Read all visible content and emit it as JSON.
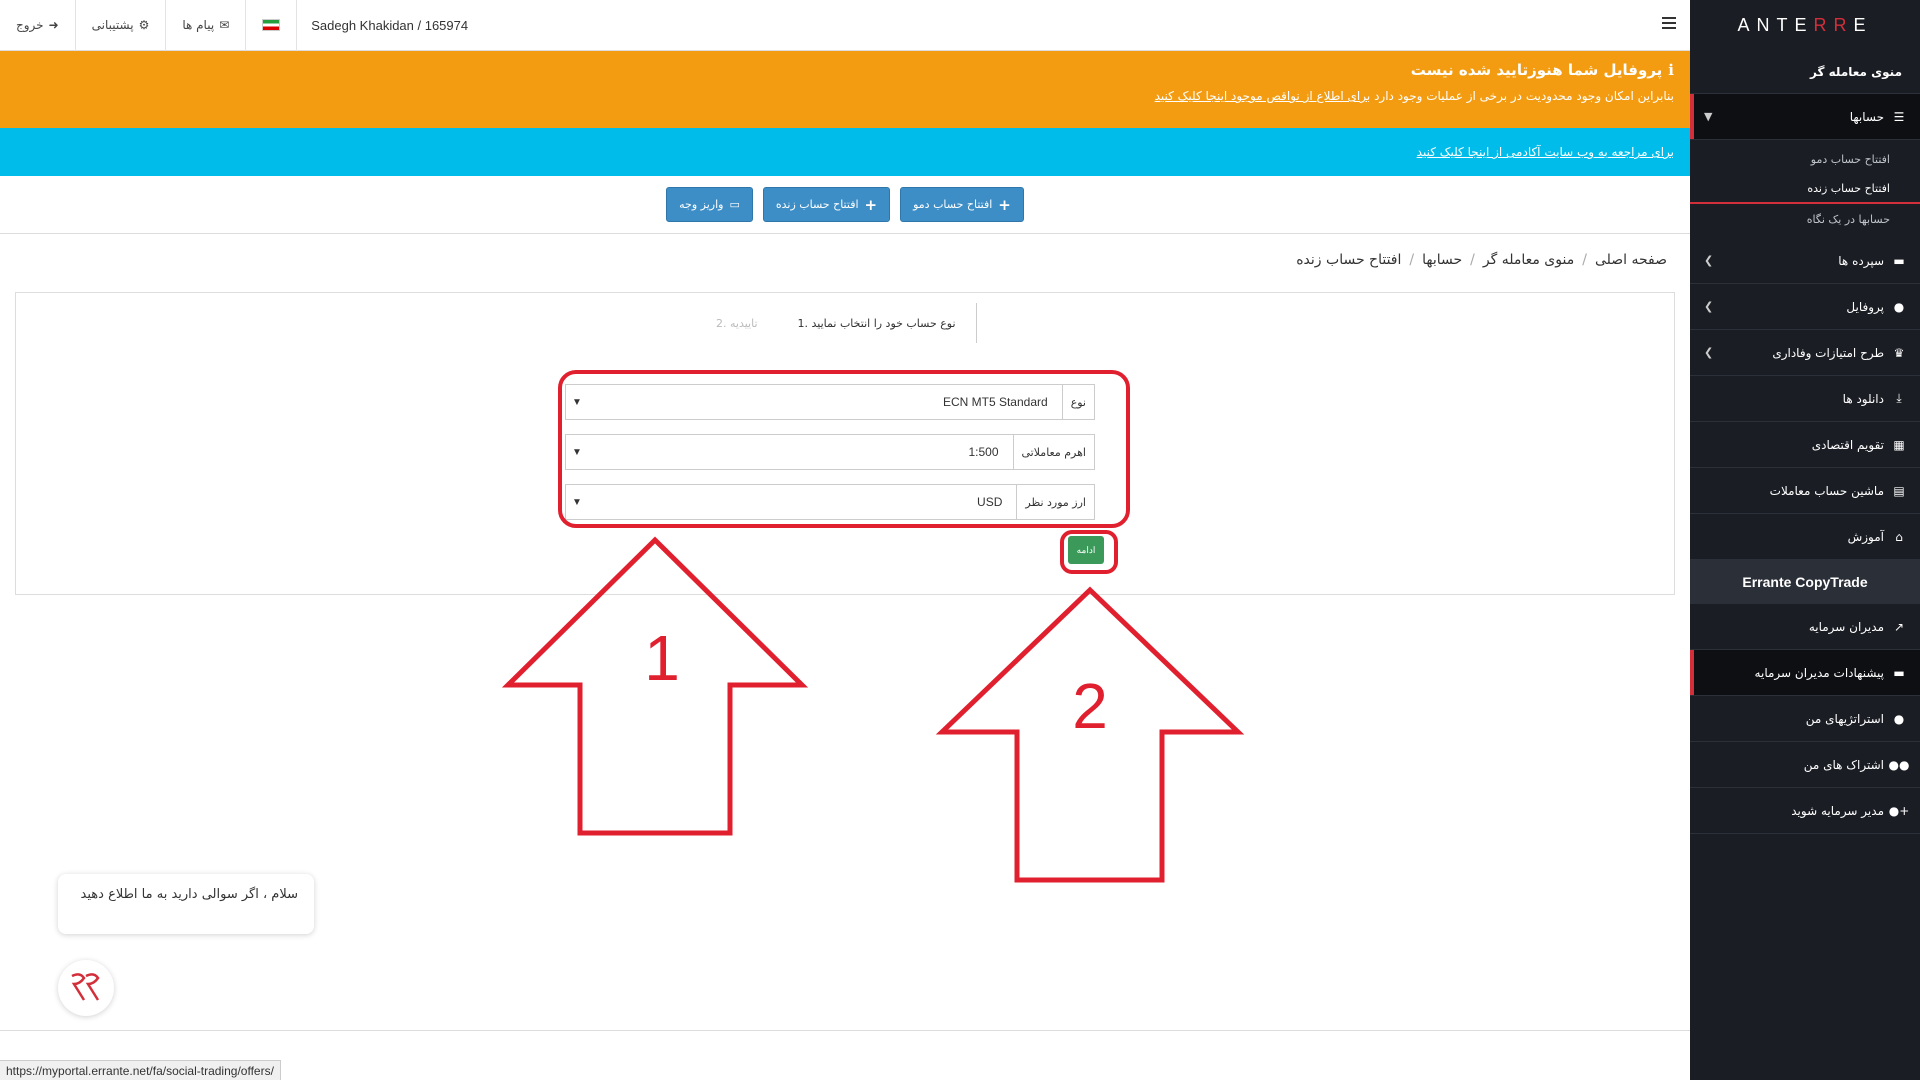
{
  "logo": {
    "pre": "E",
    "mid": "RR",
    "post": "ANTE"
  },
  "sidebar": {
    "title": "منوی معامله گر",
    "accounts": {
      "label": "حسابها",
      "sub": [
        "افتتاح حساب دمو",
        "افتتاح حساب زنده",
        "حسابها در یک نگاه"
      ]
    },
    "items": [
      {
        "label": "سپرده ها",
        "icon": "card-icon",
        "glyph": "▬",
        "chevron": true
      },
      {
        "label": "پروفایل",
        "icon": "user-icon",
        "glyph": "●",
        "chevron": true
      },
      {
        "label": "طرح امتیازات وفاداری",
        "icon": "trophy-icon",
        "glyph": "♛",
        "chevron": true
      },
      {
        "label": "دانلود ها",
        "icon": "download-icon",
        "glyph": "⤓",
        "chevron": false
      },
      {
        "label": "تقویم اقتصادی",
        "icon": "calendar-icon",
        "glyph": "▦",
        "chevron": false
      },
      {
        "label": "ماشین حساب معاملات",
        "icon": "calculator-icon",
        "glyph": "▤",
        "chevron": false
      },
      {
        "label": "آموزش",
        "icon": "institution-icon",
        "glyph": "⌂",
        "chevron": false
      }
    ],
    "copytrade_title": "Errante CopyTrade",
    "copytrade_items": [
      {
        "label": "مدیران سرمایه",
        "icon": "chart-icon",
        "glyph": "↗"
      },
      {
        "label": "پیشنهادات مدیران سرمایه",
        "icon": "card-icon",
        "glyph": "▬"
      },
      {
        "label": "استراتژیهای من",
        "icon": "user-tie-icon",
        "glyph": "●"
      },
      {
        "label": "اشتراک های من",
        "icon": "users-icon",
        "glyph": "●●"
      },
      {
        "label": "مدیر سرمایه شوید",
        "icon": "user-plus-icon",
        "glyph": "+●"
      }
    ]
  },
  "topbar": {
    "logout": "خروج",
    "support": "پشتیبانی",
    "messages": "پیام ها",
    "user": "Sadegh Khakidan / 165974"
  },
  "banner": {
    "title": "پروفایل شما هنوزتایید شده نیست",
    "text": "بنابراین امکان وجود محدودیت در برخی از عملیات وجود دارد",
    "link": "برای اطلاع از نواقص موجود اینجا کلیک کنید",
    "blue_link": "برای مراجعه به وب سایت آکادمی از اینجا کلیک کنید"
  },
  "actions": {
    "demo": "افتتاح حساب دمو",
    "live": "افتتاح حساب زنده",
    "deposit": "واریز وجه"
  },
  "breadcrumb": [
    "صفحه اصلی",
    "منوی معامله گر",
    "حسابها",
    "افتتاح حساب زنده"
  ],
  "steps": {
    "step1": "نوع حساب خود را انتخاب نمایید .1",
    "step2": "تاییدیه .2"
  },
  "form": {
    "type_label": "نوع",
    "type_value": "ECN MT5 Standard",
    "leverage_label": "اهرم معاملاتی",
    "leverage_value": "1:500",
    "currency_label": "ارز مورد نظر",
    "currency_value": "USD",
    "continue": "ادامه"
  },
  "annotations": {
    "arrow1": "1",
    "arrow2": "2",
    "color": "#e0202e"
  },
  "chat": {
    "message": "سلام ، اگر سوالی دارید به ما اطلاع دهید"
  },
  "status_url": "https://myportal.errante.net/fa/social-trading/offers/",
  "colors": {
    "sidebar": "#1a1d24",
    "orange": "#f39c12",
    "blue": "#00bcea",
    "button": "#3d8ec7",
    "continue": "#3b9a5a",
    "accent": "#d32f3a"
  }
}
